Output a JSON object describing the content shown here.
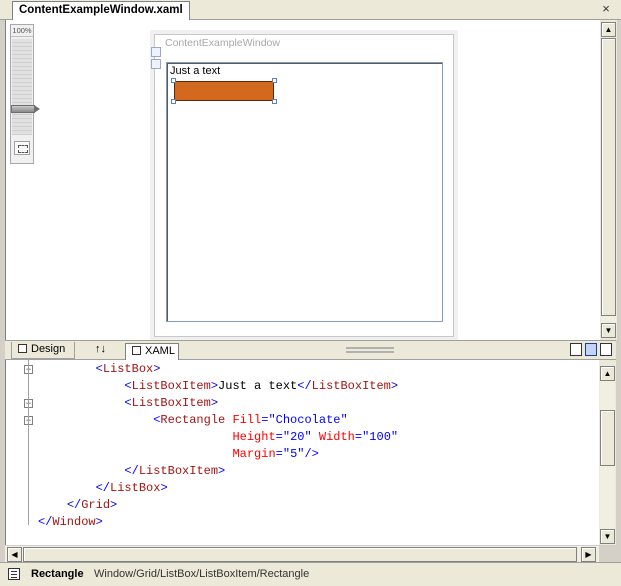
{
  "document_tab": {
    "title": "ContentExampleWindow.xaml",
    "close_glyph": "×"
  },
  "zoom": {
    "level": "100%"
  },
  "designer": {
    "window_title": "ContentExampleWindow",
    "listbox_item_text": "Just a text",
    "rectangle_fill": "#D2691E"
  },
  "view_bar": {
    "design_label": "Design",
    "swap_label": "↑↓",
    "xaml_label": "XAML"
  },
  "code_lines": [
    {
      "indent": "        ",
      "parts": [
        [
          "b",
          "<"
        ],
        [
          "t",
          "ListBox"
        ],
        [
          "b",
          ">"
        ]
      ]
    },
    {
      "indent": "            ",
      "parts": [
        [
          "b",
          "<"
        ],
        [
          "t",
          "ListBoxItem"
        ],
        [
          "b",
          ">"
        ],
        [
          "k",
          "Just a text"
        ],
        [
          "b",
          "</"
        ],
        [
          "t",
          "ListBoxItem"
        ],
        [
          "b",
          ">"
        ]
      ]
    },
    {
      "indent": "            ",
      "parts": [
        [
          "b",
          "<"
        ],
        [
          "t",
          "ListBoxItem"
        ],
        [
          "b",
          ">"
        ]
      ]
    },
    {
      "indent": "                ",
      "parts": [
        [
          "b",
          "<"
        ],
        [
          "t",
          "Rectangle"
        ],
        [
          "k",
          " "
        ],
        [
          "a",
          "Fill"
        ],
        [
          "b",
          "=\""
        ],
        [
          "v",
          "Chocolate"
        ],
        [
          "b",
          "\""
        ]
      ]
    },
    {
      "indent": "                           ",
      "parts": [
        [
          "a",
          "Height"
        ],
        [
          "b",
          "=\""
        ],
        [
          "v",
          "20"
        ],
        [
          "b",
          "\""
        ],
        [
          "k",
          " "
        ],
        [
          "a",
          "Width"
        ],
        [
          "b",
          "=\""
        ],
        [
          "v",
          "100"
        ],
        [
          "b",
          "\""
        ]
      ]
    },
    {
      "indent": "                           ",
      "parts": [
        [
          "a",
          "Margin"
        ],
        [
          "b",
          "=\""
        ],
        [
          "v",
          "5"
        ],
        [
          "b",
          "\"/>"
        ]
      ]
    },
    {
      "indent": "            ",
      "parts": [
        [
          "b",
          "</"
        ],
        [
          "t",
          "ListBoxItem"
        ],
        [
          "b",
          ">"
        ]
      ]
    },
    {
      "indent": "        ",
      "parts": [
        [
          "b",
          "</"
        ],
        [
          "t",
          "ListBox"
        ],
        [
          "b",
          ">"
        ]
      ]
    },
    {
      "indent": "    ",
      "parts": [
        [
          "b",
          "</"
        ],
        [
          "t",
          "Grid"
        ],
        [
          "b",
          ">"
        ]
      ]
    },
    {
      "indent": "",
      "parts": [
        [
          "b",
          "</"
        ],
        [
          "t",
          "Window"
        ],
        [
          "b",
          ">"
        ]
      ]
    }
  ],
  "status": {
    "selected_element": "Rectangle",
    "path": "Window/Grid/ListBox/ListBoxItem/Rectangle"
  },
  "icons": {
    "close": "close-icon",
    "zoom_fit": "zoom-fit-icon",
    "design": "design-view-icon",
    "swap": "swap-panes-icon",
    "xaml": "xaml-view-icon",
    "element": "element-icon"
  }
}
